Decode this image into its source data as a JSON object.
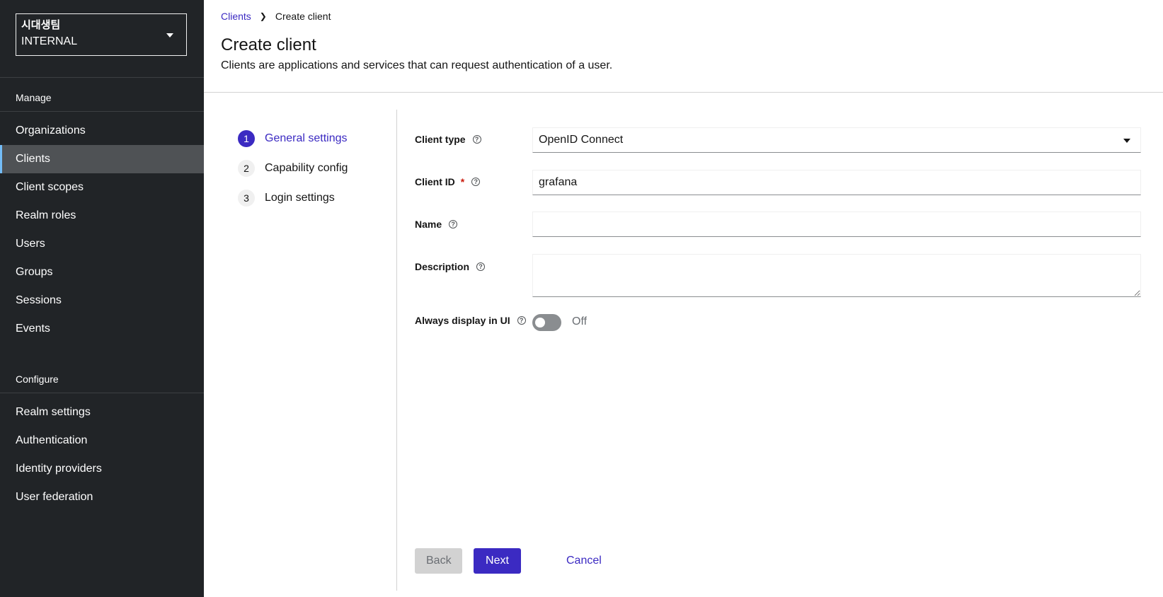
{
  "sidebar": {
    "realm_name": "시대생팀",
    "realm_sub": "INTERNAL",
    "manage_heading": "Manage",
    "manage_items": [
      "Organizations",
      "Clients",
      "Client scopes",
      "Realm roles",
      "Users",
      "Groups",
      "Sessions",
      "Events"
    ],
    "active_item": "Clients",
    "configure_heading": "Configure",
    "configure_items": [
      "Realm settings",
      "Authentication",
      "Identity providers",
      "User federation"
    ]
  },
  "breadcrumb": {
    "parent": "Clients",
    "current": "Create client"
  },
  "page": {
    "title": "Create client",
    "description": "Clients are applications and services that can request authentication of a user."
  },
  "wizard": {
    "steps": [
      {
        "num": "1",
        "label": "General settings"
      },
      {
        "num": "2",
        "label": "Capability config"
      },
      {
        "num": "3",
        "label": "Login settings"
      }
    ],
    "current_step": 1
  },
  "form": {
    "client_type": {
      "label": "Client type",
      "value": "OpenID Connect"
    },
    "client_id": {
      "label": "Client ID",
      "required": "*",
      "value": "grafana"
    },
    "name": {
      "label": "Name",
      "value": ""
    },
    "description": {
      "label": "Description",
      "value": ""
    },
    "always_display": {
      "label": "Always display in UI",
      "state": "Off"
    }
  },
  "buttons": {
    "back": "Back",
    "next": "Next",
    "cancel": "Cancel"
  },
  "colors": {
    "accent": "#3b2ac2",
    "sidebar_bg": "#212427",
    "active_nav_bg": "#4f5255",
    "active_nav_border": "#73bcf7"
  }
}
